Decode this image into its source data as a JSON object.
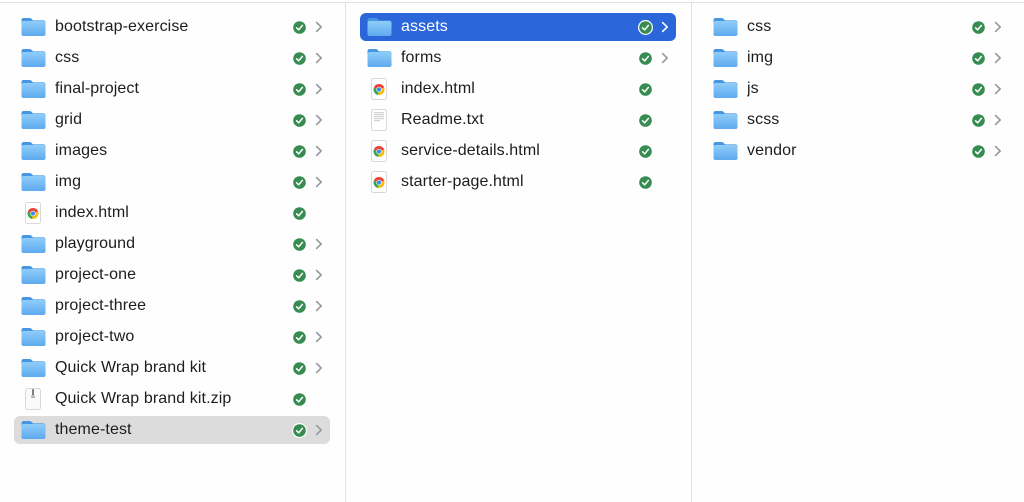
{
  "colors": {
    "accent_blue": "#2B66DA",
    "selection_gray": "#DCDCDC",
    "check_green": "#378C52",
    "chevron_gray": "#98989D",
    "divider_gray": "#E2E2E2",
    "text_dark": "#1D1D1F",
    "folder_blue_top": "#4796E3",
    "folder_blue_light": "#8ECDF9",
    "folder_blue_dark": "#5EA9EF"
  },
  "icon_names": {
    "folder": "blue-folder-icon",
    "html": "chrome-html-file-icon",
    "zip": "zip-archive-icon",
    "txt": "plain-text-file-icon"
  },
  "columns": [
    {
      "name": "column-1",
      "items": [
        {
          "label": "bootstrap-exercise",
          "type": "folder",
          "chevron": true,
          "check_badge": true
        },
        {
          "label": "css",
          "type": "folder",
          "chevron": true,
          "check_badge": true
        },
        {
          "label": "final-project",
          "type": "folder",
          "chevron": true,
          "check_badge": true
        },
        {
          "label": "grid",
          "type": "folder",
          "chevron": true,
          "check_badge": true
        },
        {
          "label": "images",
          "type": "folder",
          "chevron": true,
          "check_badge": true
        },
        {
          "label": "img",
          "type": "folder",
          "chevron": true,
          "check_badge": true
        },
        {
          "label": "index.html",
          "type": "html",
          "chevron": false,
          "check_badge": true
        },
        {
          "label": "playground",
          "type": "folder",
          "chevron": true,
          "check_badge": true
        },
        {
          "label": "project-one",
          "type": "folder",
          "chevron": true,
          "check_badge": true
        },
        {
          "label": "project-three",
          "type": "folder",
          "chevron": true,
          "check_badge": true
        },
        {
          "label": "project-two",
          "type": "folder",
          "chevron": true,
          "check_badge": true
        },
        {
          "label": "Quick Wrap brand kit",
          "type": "folder",
          "chevron": true,
          "check_badge": true
        },
        {
          "label": "Quick Wrap brand kit.zip",
          "type": "zip",
          "chevron": false,
          "check_badge": true
        },
        {
          "label": "theme-test",
          "type": "folder",
          "chevron": true,
          "check_badge": true,
          "selected": "inactive"
        }
      ]
    },
    {
      "name": "column-2",
      "items": [
        {
          "label": "assets",
          "type": "folder",
          "chevron": true,
          "check_badge": true,
          "selected": "active"
        },
        {
          "label": "forms",
          "type": "folder",
          "chevron": true,
          "check_badge": true
        },
        {
          "label": "index.html",
          "type": "html",
          "chevron": false,
          "check_badge": true
        },
        {
          "label": "Readme.txt",
          "type": "txt",
          "chevron": false,
          "check_badge": true
        },
        {
          "label": "service-details.html",
          "type": "html",
          "chevron": false,
          "check_badge": true
        },
        {
          "label": "starter-page.html",
          "type": "html",
          "chevron": false,
          "check_badge": true
        }
      ]
    },
    {
      "name": "column-3",
      "items": [
        {
          "label": "css",
          "type": "folder",
          "chevron": true,
          "check_badge": true
        },
        {
          "label": "img",
          "type": "folder",
          "chevron": true,
          "check_badge": true
        },
        {
          "label": "js",
          "type": "folder",
          "chevron": true,
          "check_badge": true
        },
        {
          "label": "scss",
          "type": "folder",
          "chevron": true,
          "check_badge": true
        },
        {
          "label": "vendor",
          "type": "folder",
          "chevron": true,
          "check_badge": true
        }
      ]
    }
  ]
}
